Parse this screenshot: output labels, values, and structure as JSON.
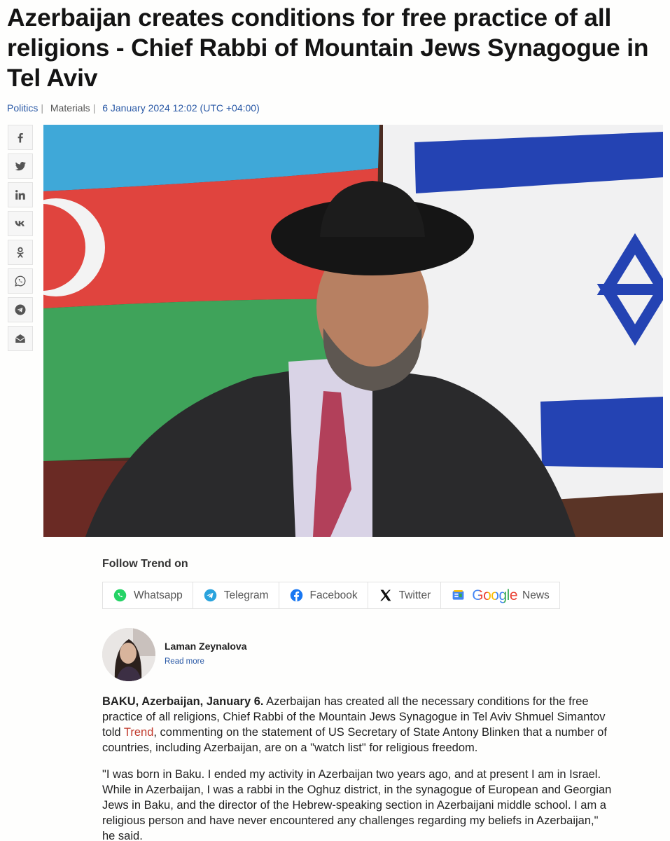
{
  "article": {
    "title": "Azerbaijan creates conditions for free practice of all religions - Chief Rabbi of Mountain Jews Synagogue in Tel Aviv",
    "category": "Politics",
    "section": "Materials",
    "datetime": "6 January 2024 12:02 (UTC +04:00)"
  },
  "share_icons": [
    "facebook-icon",
    "twitter-icon",
    "linkedin-icon",
    "vk-icon",
    "odnoklassniki-icon",
    "whatsapp-icon",
    "telegram-icon",
    "email-icon"
  ],
  "follow": {
    "title": "Follow Trend on",
    "buttons": [
      {
        "label": "Whatsapp",
        "icon": "whatsapp-icon"
      },
      {
        "label": "Telegram",
        "icon": "telegram-icon"
      },
      {
        "label": "Facebook",
        "icon": "facebook-icon"
      },
      {
        "label": "Twitter",
        "icon": "x-icon"
      },
      {
        "label": "News",
        "icon": "google-news-icon",
        "brand": "Google"
      }
    ]
  },
  "author": {
    "name": "Laman Zeynalova",
    "read_more": "Read more"
  },
  "body": {
    "p1_dateline": "BAKU, Azerbaijan, January 6.",
    "p1_before": " Azerbaijan has created all the necessary conditions for the free practice of all religions, Chief Rabbi of the Mountain Jews Synagogue in Tel Aviv Shmuel Simantov told ",
    "p1_link": "Trend",
    "p1_after": ", commenting on the statement of US Secretary of State Antony Blinken that a number of countries, including Azerbaijan, are on a \"watch list\" for religious freedom.",
    "p2": "\"I was born in Baku. I ended my activity in Azerbaijan two years ago, and at present I am in Israel. While in Azerbaijan, I was a rabbi in the Oghuz district, in the synagogue of European and Georgian Jews in Baku, and the director of the Hebrew-speaking section in Azerbaijani middle school. I am a religious person and have never encountered any challenges regarding my beliefs in Azerbaijan,\" he said."
  },
  "colors": {
    "link": "#2a59a6",
    "trend_link": "#c0392b",
    "az_blue": "#3fa8d8",
    "az_red": "#e0443e",
    "az_green": "#3fa35a",
    "israel_blue": "#2443b3"
  }
}
